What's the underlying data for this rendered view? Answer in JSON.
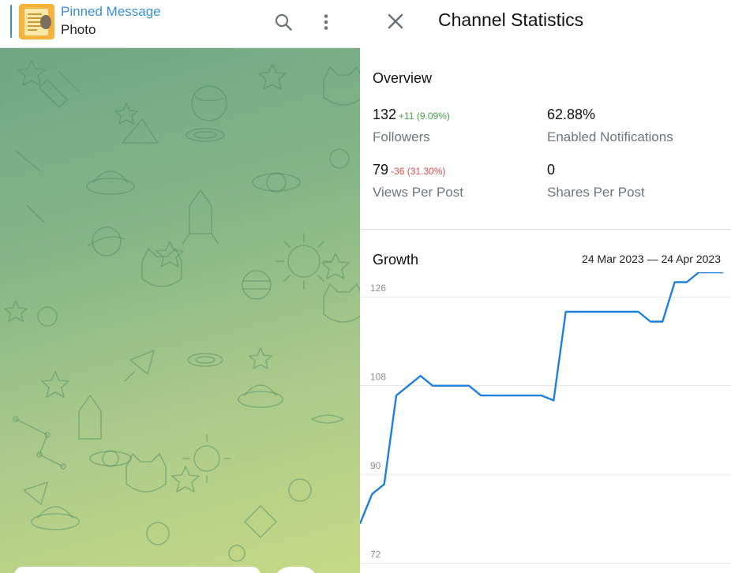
{
  "pinned": {
    "title": "Pinned Message",
    "subtitle": "Photo"
  },
  "icons": {
    "search": "search-icon",
    "menu": "more-vertical-icon",
    "close": "close-icon"
  },
  "stats": {
    "title": "Channel Statistics",
    "overview_title": "Overview",
    "overview": [
      {
        "value": "132",
        "delta": "+11 (9.09%)",
        "trend": "up",
        "label": "Followers"
      },
      {
        "value": "62.88%",
        "delta": "",
        "trend": "none",
        "label": "Enabled Notifications"
      },
      {
        "value": "79",
        "delta": "-36 (31.30%)",
        "trend": "down",
        "label": "Views Per Post"
      },
      {
        "value": "0",
        "delta": "",
        "trend": "none",
        "label": "Shares Per Post"
      }
    ],
    "growth_title": "Growth",
    "date_range": "24 Mar 2023 — 24 Apr 2023"
  },
  "colors": {
    "accent": "#3a8fd6",
    "line": "#1d7fe0",
    "positive": "#49a24a",
    "negative": "#dc4b4b"
  },
  "chart_data": {
    "type": "line",
    "title": "Growth",
    "xlabel": "",
    "ylabel": "",
    "ylim": [
      70,
      131
    ],
    "yticks": [
      72,
      90,
      108,
      126
    ],
    "grid": true,
    "legend": "none",
    "series": [
      {
        "values": [
          80,
          86,
          88,
          106,
          108,
          110,
          108,
          108,
          108,
          108,
          106,
          106,
          106,
          106,
          106,
          106,
          105,
          123,
          123,
          123,
          123,
          123,
          123,
          123,
          121,
          121,
          129,
          129,
          131,
          131,
          131
        ]
      }
    ]
  }
}
